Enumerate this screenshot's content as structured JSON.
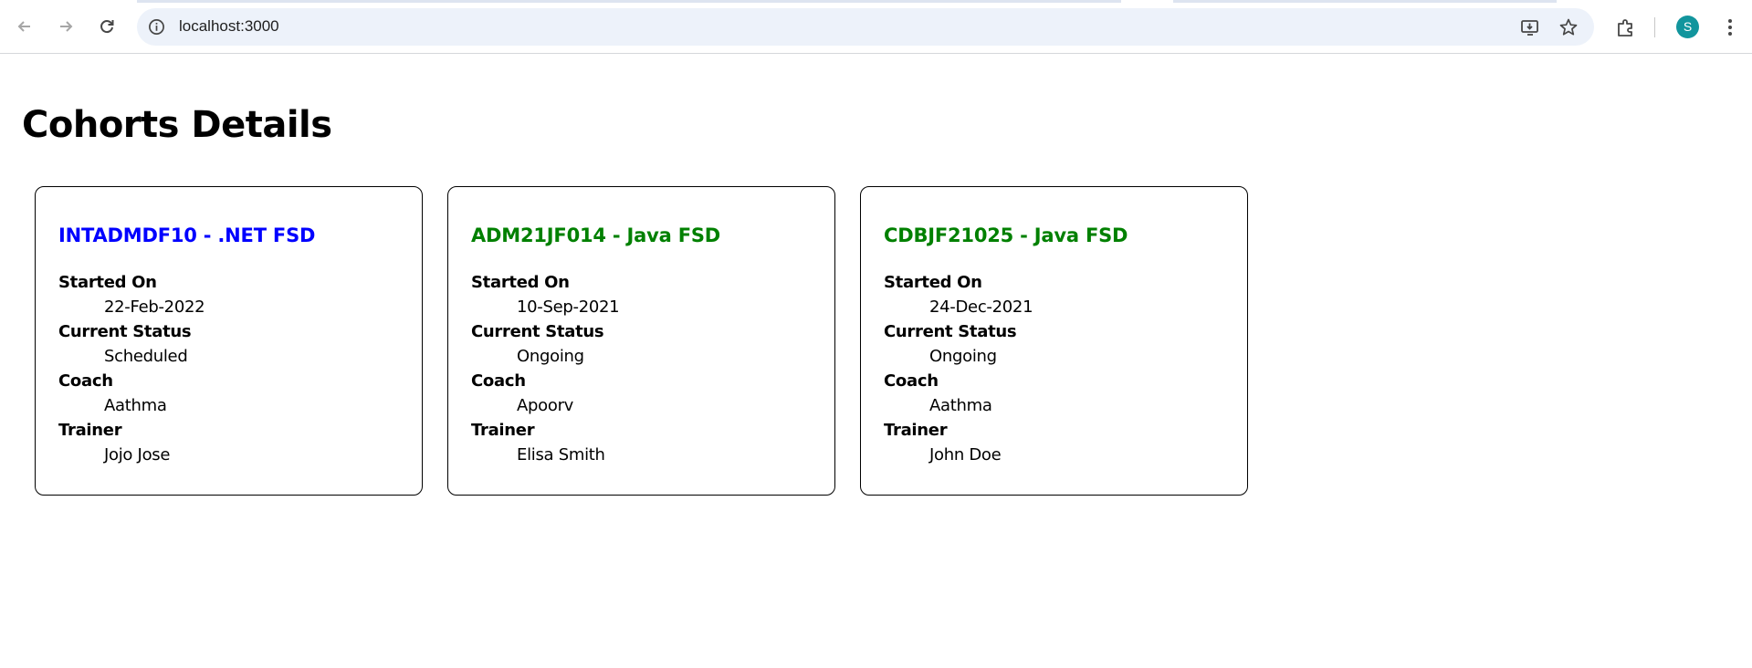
{
  "browser": {
    "url": "localhost:3000",
    "profile_initial": "S",
    "profile_color": "#12959d",
    "icons": {
      "back": "arrow-left-icon",
      "forward": "arrow-right-icon",
      "reload": "reload-icon",
      "site_info": "info-icon",
      "install": "install-app-icon",
      "bookmark": "star-icon",
      "extensions": "puzzle-icon",
      "menu": "kebab-menu-icon"
    }
  },
  "page": {
    "title": "Cohorts Details"
  },
  "colors": {
    "scheduled_title": "#0000ff",
    "ongoing_title": "#008000"
  },
  "cohorts": [
    {
      "title": "INTADMDF10 - .NET FSD",
      "status_color": "#0000ff",
      "started_on_label": "Started On",
      "started_on": "22-Feb-2022",
      "status_label": "Current Status",
      "status": "Scheduled",
      "coach_label": "Coach",
      "coach": "Aathma",
      "trainer_label": "Trainer",
      "trainer": "Jojo Jose"
    },
    {
      "title": "ADM21JF014 - Java FSD",
      "status_color": "#008000",
      "started_on_label": "Started On",
      "started_on": "10-Sep-2021",
      "status_label": "Current Status",
      "status": "Ongoing",
      "coach_label": "Coach",
      "coach": "Apoorv",
      "trainer_label": "Trainer",
      "trainer": "Elisa Smith"
    },
    {
      "title": "CDBJF21025 - Java FSD",
      "status_color": "#008000",
      "started_on_label": "Started On",
      "started_on": "24-Dec-2021",
      "status_label": "Current Status",
      "status": "Ongoing",
      "coach_label": "Coach",
      "coach": "Aathma",
      "trainer_label": "Trainer",
      "trainer": "John Doe"
    }
  ]
}
